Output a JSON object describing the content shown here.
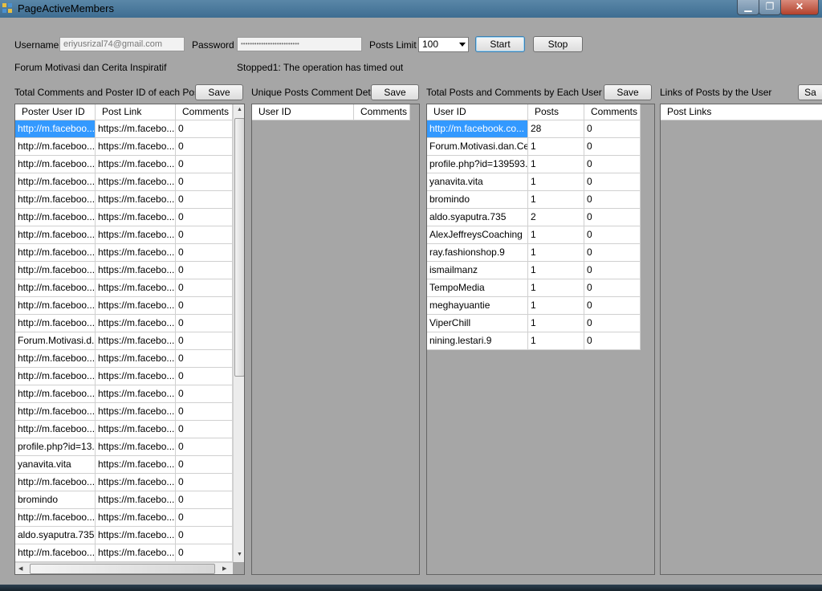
{
  "window": {
    "title": "PageActiveMembers",
    "min_glyph": "▁",
    "max_glyph": "❐",
    "close_glyph": "✕"
  },
  "form": {
    "username_label": "Username",
    "username_value": "eriyusrizal74@gmail.com",
    "password_label": "Password",
    "password_value": "••••••••••••••••••••••••••",
    "posts_limit_label": "Posts Limit",
    "posts_limit_value": "100",
    "start_label": "Start",
    "stop_label": "Stop",
    "page_name": "Forum Motivasi dan Cerita Inspiratif",
    "status": "Stopped1: The operation has timed out"
  },
  "panels": {
    "p1": {
      "title": "Total Comments and Poster ID of each Post",
      "save": "Save",
      "headers": [
        "Poster User ID",
        "Post Link",
        "Comments"
      ]
    },
    "p2": {
      "title": "Unique Posts Comment Details",
      "save": "Save",
      "headers": [
        "User ID",
        "Comments"
      ]
    },
    "p3": {
      "title": "Total Posts and Comments by Each User",
      "save": "Save",
      "headers": [
        "User ID",
        "Posts",
        "Comments"
      ]
    },
    "p4": {
      "title": "Links of Posts by the User",
      "save": "Sa",
      "headers": [
        "Post Links"
      ]
    }
  },
  "posts_grid": [
    [
      "http://m.faceboo...",
      "https://m.facebo...",
      "0"
    ],
    [
      "http://m.faceboo...",
      "https://m.facebo...",
      "0"
    ],
    [
      "http://m.faceboo...",
      "https://m.facebo...",
      "0"
    ],
    [
      "http://m.faceboo...",
      "https://m.facebo...",
      "0"
    ],
    [
      "http://m.faceboo...",
      "https://m.facebo...",
      "0"
    ],
    [
      "http://m.faceboo...",
      "https://m.facebo...",
      "0"
    ],
    [
      "http://m.faceboo...",
      "https://m.facebo...",
      "0"
    ],
    [
      "http://m.faceboo...",
      "https://m.facebo...",
      "0"
    ],
    [
      "http://m.faceboo...",
      "https://m.facebo...",
      "0"
    ],
    [
      "http://m.faceboo...",
      "https://m.facebo...",
      "0"
    ],
    [
      "http://m.faceboo...",
      "https://m.facebo...",
      "0"
    ],
    [
      "http://m.faceboo...",
      "https://m.facebo...",
      "0"
    ],
    [
      "Forum.Motivasi.d...",
      "https://m.facebo...",
      "0"
    ],
    [
      "http://m.faceboo...",
      "https://m.facebo...",
      "0"
    ],
    [
      "http://m.faceboo...",
      "https://m.facebo...",
      "0"
    ],
    [
      "http://m.faceboo...",
      "https://m.facebo...",
      "0"
    ],
    [
      "http://m.faceboo...",
      "https://m.facebo...",
      "0"
    ],
    [
      "http://m.faceboo...",
      "https://m.facebo...",
      "0"
    ],
    [
      "profile.php?id=13...",
      "https://m.facebo...",
      "0"
    ],
    [
      "yanavita.vita",
      "https://m.facebo...",
      "0"
    ],
    [
      "http://m.faceboo...",
      "https://m.facebo...",
      "0"
    ],
    [
      "bromindo",
      "https://m.facebo...",
      "0"
    ],
    [
      "http://m.faceboo...",
      "https://m.facebo...",
      "0"
    ],
    [
      "aldo.syaputra.735",
      "https://m.facebo...",
      "0"
    ],
    [
      "http://m.faceboo...",
      "https://m.facebo...",
      "0"
    ]
  ],
  "users_grid": [
    [
      "http://m.facebook.co...",
      "28",
      "0"
    ],
    [
      "Forum.Motivasi.dan.Ce...",
      "1",
      "0"
    ],
    [
      "profile.php?id=139593...",
      "1",
      "0"
    ],
    [
      "yanavita.vita",
      "1",
      "0"
    ],
    [
      "bromindo",
      "1",
      "0"
    ],
    [
      "aldo.syaputra.735",
      "2",
      "0"
    ],
    [
      "AlexJeffreysCoaching",
      "1",
      "0"
    ],
    [
      "ray.fashionshop.9",
      "1",
      "0"
    ],
    [
      "ismailmanz",
      "1",
      "0"
    ],
    [
      "TempoMedia",
      "1",
      "0"
    ],
    [
      "meghayuantie",
      "1",
      "0"
    ],
    [
      "ViperChill",
      "1",
      "0"
    ],
    [
      "nining.lestari.9",
      "1",
      "0"
    ]
  ],
  "colors": {
    "selection": "#3399ff",
    "client_bg": "#a6a6a6"
  }
}
